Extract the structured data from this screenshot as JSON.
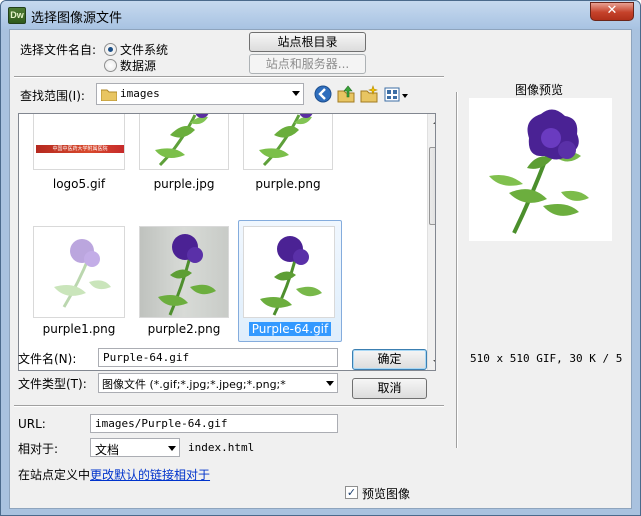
{
  "window": {
    "app_icon": "Dw",
    "title": "选择图像源文件",
    "close_label": "✕"
  },
  "source": {
    "label": "选择文件名自:",
    "options": [
      "文件系统",
      "数据源"
    ],
    "selected": "文件系统"
  },
  "site_buttons": {
    "site_root": "站点根目录",
    "sites_servers": "站点和服务器..."
  },
  "look_in": {
    "label": "查找范围(I):",
    "value": "images",
    "toolbar_icons": [
      "back-arrow-icon",
      "up-folder-icon",
      "new-folder-icon",
      "view-menu-icon"
    ]
  },
  "files": [
    {
      "name": "logo5.gif",
      "banner_text": "中国中医药大学附属医院"
    },
    {
      "name": "purple.jpg"
    },
    {
      "name": "purple.png"
    },
    {
      "name": "purple1.png"
    },
    {
      "name": "purple2.png"
    },
    {
      "name": "Purple-64.gif",
      "selected": true
    }
  ],
  "filename": {
    "label": "文件名(N):",
    "value": "Purple-64.gif"
  },
  "filetype": {
    "label": "文件类型(T):",
    "value": "图像文件 (*.gif;*.jpg;*.jpeg;*.png;*"
  },
  "actions": {
    "ok": "确定",
    "cancel": "取消"
  },
  "url": {
    "label": "URL:",
    "value": "images/Purple-64.gif"
  },
  "relative": {
    "label": "相对于:",
    "value": "文档",
    "target": "index.html"
  },
  "site_def": {
    "prefix": "在站点定义中",
    "link": "更改默认的链接相对于"
  },
  "preview": {
    "title": "图像预览",
    "info": "510 x 510 GIF, 30 K / 5",
    "checkbox_label": "预览图像",
    "checked": true
  }
}
